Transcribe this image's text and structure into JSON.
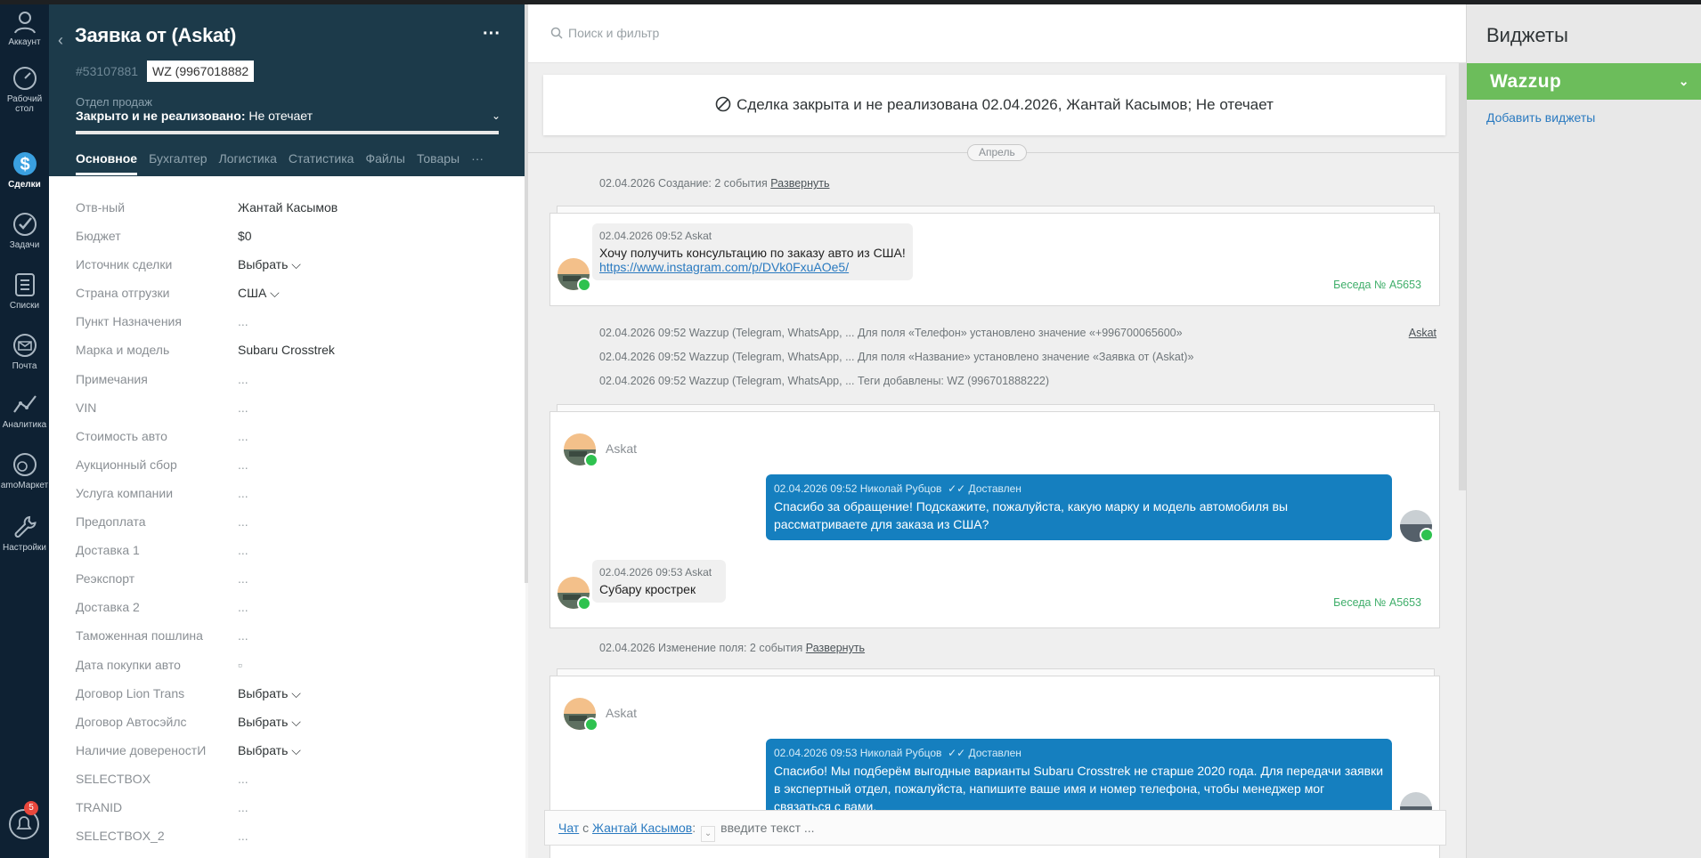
{
  "nav": {
    "items": [
      {
        "label": "Аккаунт",
        "icon": "account-icon"
      },
      {
        "label": "Рабочий стол",
        "icon": "dashboard-icon"
      },
      {
        "label": "Сделки",
        "icon": "deals-icon"
      },
      {
        "label": "Задачи",
        "icon": "tasks-icon"
      },
      {
        "label": "Списки",
        "icon": "lists-icon"
      },
      {
        "label": "Почта",
        "icon": "mail-icon"
      },
      {
        "label": "Аналитика",
        "icon": "analytics-icon"
      },
      {
        "label": "amoМаркет",
        "icon": "market-icon"
      },
      {
        "label": "Настройки",
        "icon": "settings-icon"
      }
    ],
    "notifications_count": "5"
  },
  "lead": {
    "title": "Заявка от (Askat)",
    "id": "#53107881",
    "tag": "WZ (9967018882",
    "pipeline": "Отдел продаж",
    "status_label": "Закрыто и не реализовано:",
    "status_reason": "Не отечает",
    "tabs": [
      "Основное",
      "Бухгалтер",
      "Логистика",
      "Статистика",
      "Файлы",
      "Товары",
      "···"
    ]
  },
  "fields": [
    {
      "label": "Отв-ный",
      "value": "Жантай Касымов"
    },
    {
      "label": "Бюджет",
      "value": "$0"
    },
    {
      "label": "Источник сделки",
      "value": "Выбрать ⌵"
    },
    {
      "label": "Страна отгрузки",
      "value": "США ⌵"
    },
    {
      "label": "Пункт Назначения",
      "value": "..."
    },
    {
      "label": "Марка и модель",
      "value": "Subaru Crosstrek"
    },
    {
      "label": "Примечания",
      "value": "..."
    },
    {
      "label": "VIN",
      "value": "..."
    },
    {
      "label": "Стоимость авто",
      "value": "..."
    },
    {
      "label": "Аукционный сбор",
      "value": "..."
    },
    {
      "label": "Услуга компании",
      "value": "..."
    },
    {
      "label": "Предоплата",
      "value": "..."
    },
    {
      "label": "Доставка 1",
      "value": "..."
    },
    {
      "label": "Реэкспорт",
      "value": "..."
    },
    {
      "label": "Доставка 2",
      "value": "..."
    },
    {
      "label": "Таможенная пошлина",
      "value": "..."
    },
    {
      "label": "Дата покупки авто",
      "value": "▫"
    },
    {
      "label": "Договор Lion Trans",
      "value": "Выбрать ⌵"
    },
    {
      "label": "Договор Автосэйлс",
      "value": "Выбрать ⌵"
    },
    {
      "label": "Наличие довереностИ",
      "value": "Выбрать ⌵"
    },
    {
      "label": "SELECTBOX",
      "value": "..."
    },
    {
      "label": "TRANID",
      "value": "..."
    },
    {
      "label": "SELECTBOX_2",
      "value": "..."
    }
  ],
  "feed": {
    "search_placeholder": "Поиск и фильтр",
    "closed_notice": "Сделка закрыта и не реализована 02.04.2026, Жантай Касымов; Не отечает",
    "month": "Апрель",
    "events": {
      "created": "02.04.2026 Создание: 2 события",
      "expand": "Развернуть",
      "e1": "02.04.2026 09:52 Wazzup (Telegram, WhatsApp, ... Для поля «Телефон» установлено значение «+996700065600»",
      "e1_author": "Askat",
      "e2": "02.04.2026 09:52 Wazzup (Telegram, WhatsApp, ... Для поля «Название» установлено значение «Заявка от (Askat)»",
      "e3": "02.04.2026 09:52 Wazzup (Telegram, WhatsApp, ... Теги добавлены: WZ (996701888222)",
      "changed": "02.04.2026 Изменение поля: 2 события"
    },
    "msg1": {
      "meta": "02.04.2026 09:52 Askat",
      "text": "Хочу получить консультацию по заказу авто из США!",
      "link": "https://www.instagram.com/p/DVk0FxuAOe5/",
      "conversation": "Беседа № A5653"
    },
    "sender_name": "Askat",
    "msg2": {
      "meta": "02.04.2026 09:52 Николай Рубцов",
      "status": "✓✓ Доставлен",
      "text": "Спасибо за обращение! Подскажите, пожалуйста, какую марку и модель автомобиля вы рассматриваете для заказа из США?"
    },
    "msg3": {
      "meta": "02.04.2026 09:53 Askat",
      "text": "Субару крострек",
      "conversation": "Беседа № A5653"
    },
    "msg4": {
      "meta": "02.04.2026 09:53 Николай Рубцов",
      "status": "✓✓ Доставлен",
      "text": "Спасибо! Мы подберём выгодные варианты Subaru Crosstrek не старше 2020 года. Для передачи заявки в экспертный отдел, пожалуйста, напишите ваше имя и номер телефона, чтобы менеджер мог связаться с вами."
    },
    "chat": {
      "chat_label": "Чат",
      "with": "с",
      "contact": "Жантай Касымов",
      "placeholder": "введите текст ..."
    }
  },
  "widgets": {
    "title": "Виджеты",
    "wazzup": "Wazzup",
    "add": "Добавить виджеты"
  },
  "colors": {
    "nav_bg": "#0e2133",
    "header_bg": "#1c3a4a",
    "outgoing": "#157fbf",
    "wazzup": "#6cbd5b",
    "whatsapp": "#2ec24f"
  }
}
